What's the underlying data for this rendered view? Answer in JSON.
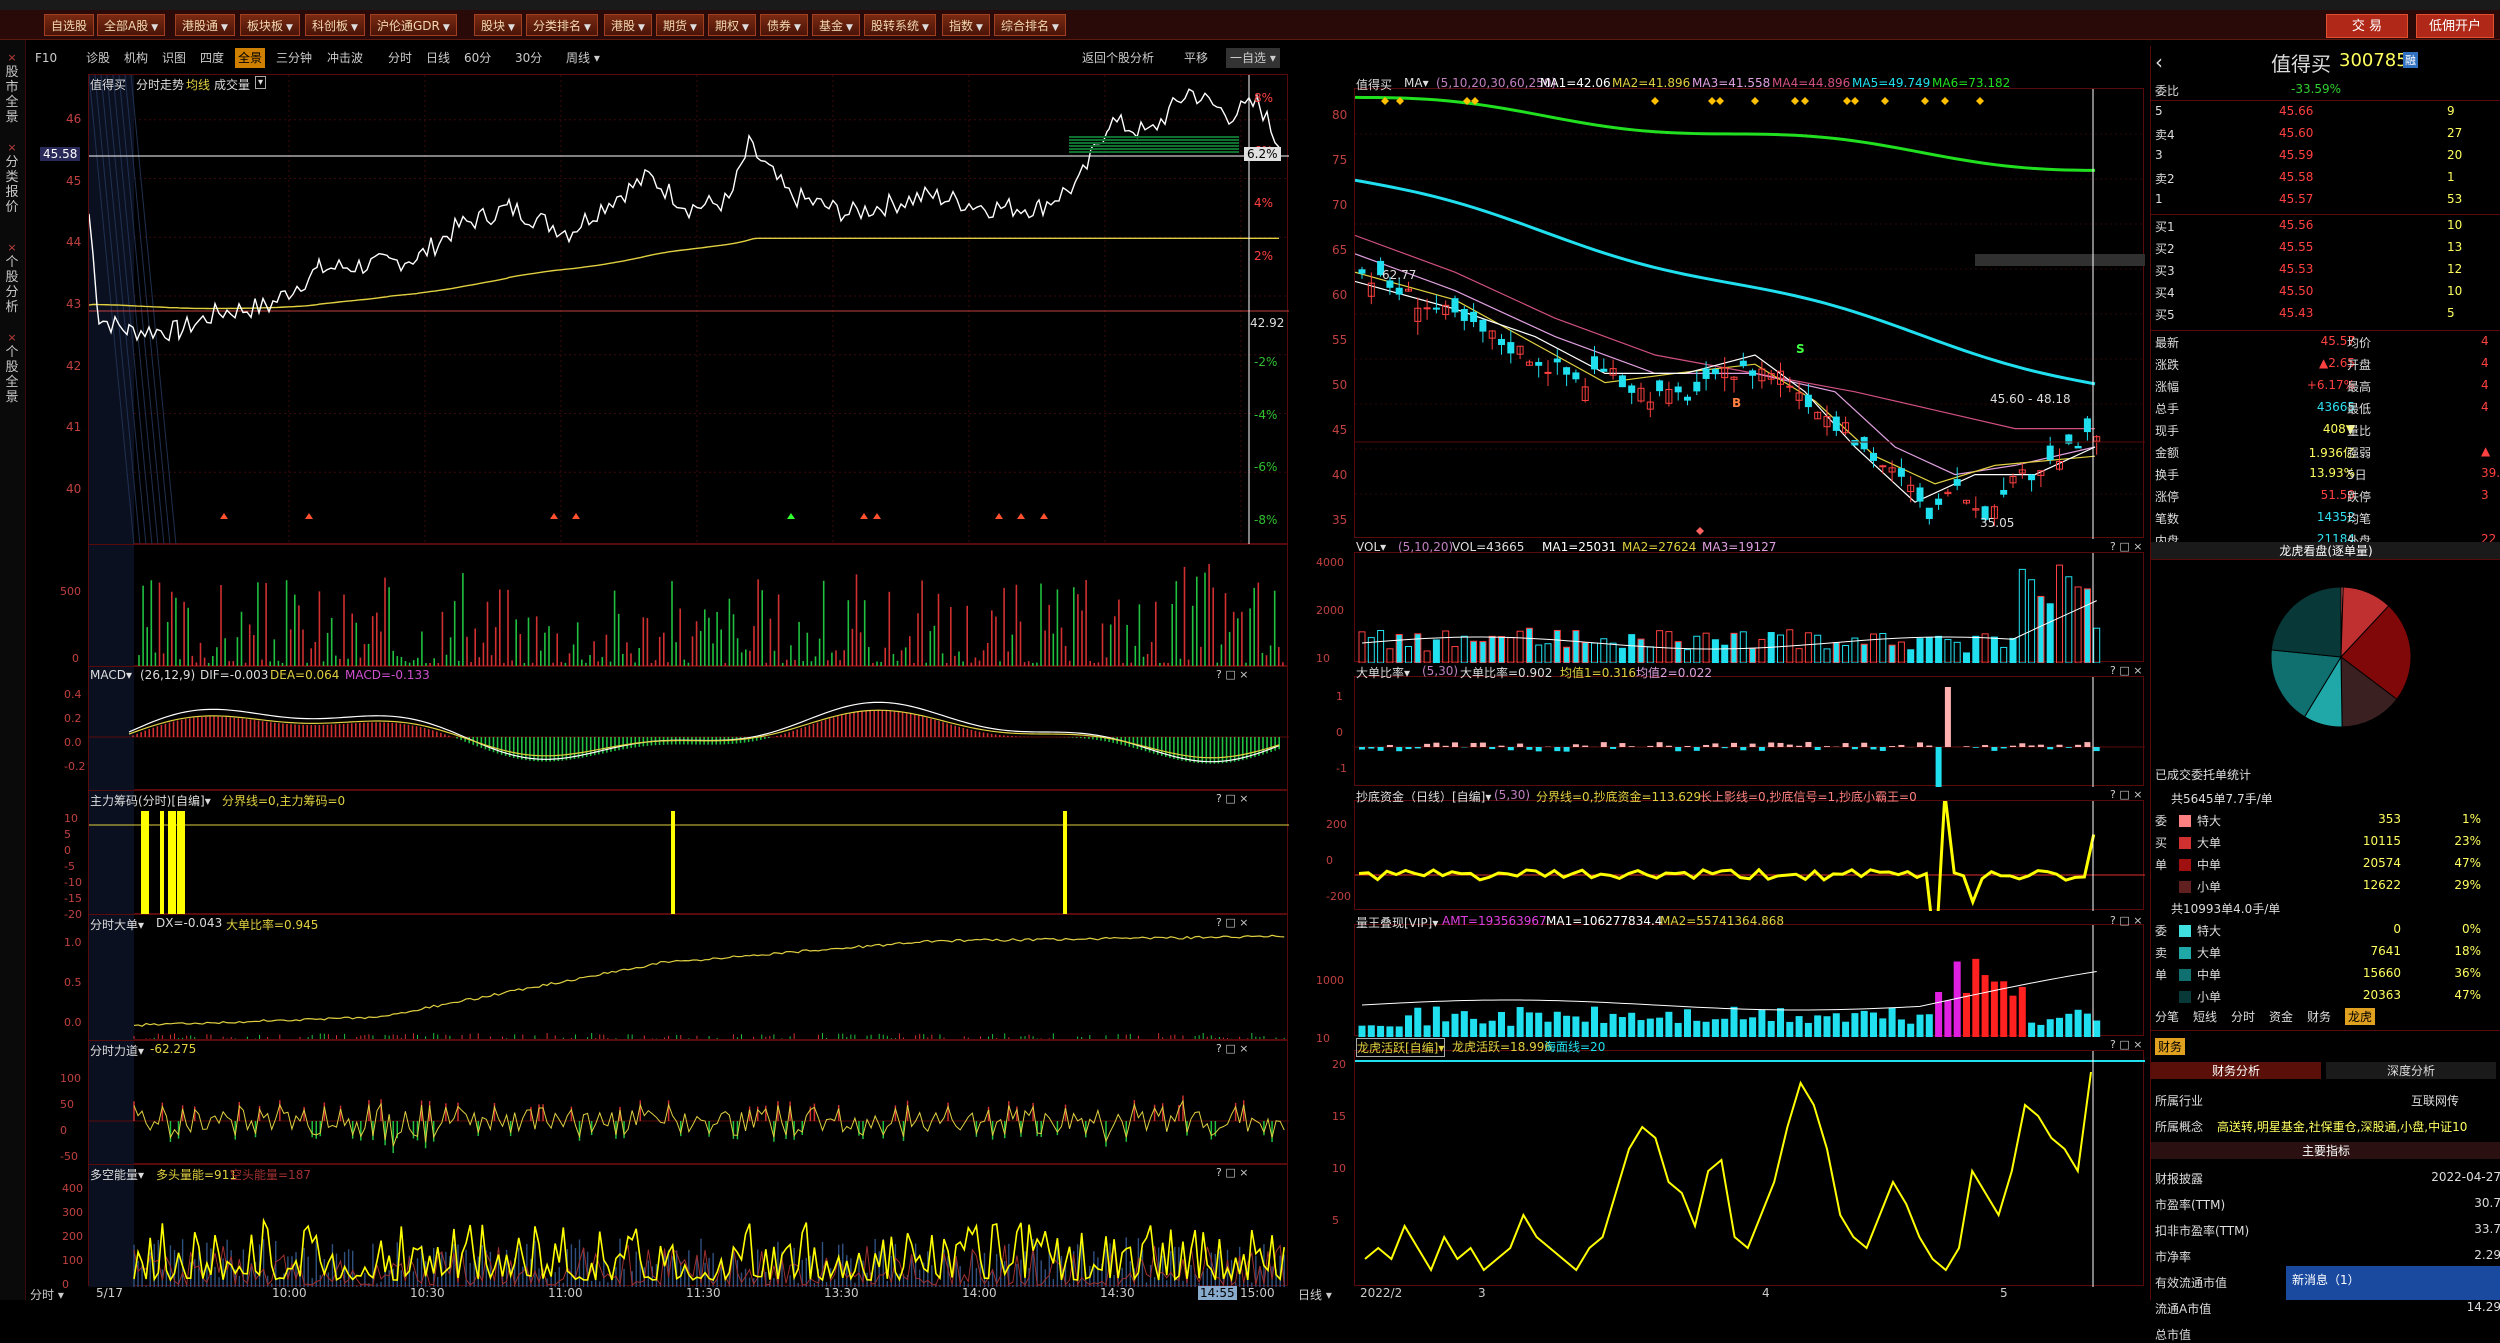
{
  "menu": {
    "items": [
      "自选股",
      "全部A股",
      "港股通",
      "板块板",
      "科创板",
      "沪伦通GDR",
      "股块",
      "分类排名",
      "港股",
      "期货",
      "期权",
      "债券",
      "基金",
      "股转系统",
      "指数",
      "综合排名"
    ],
    "trade": "交 易",
    "open": "低佣开户"
  },
  "left_tabs": [
    "股市全景",
    "分类报价",
    "个股分析",
    "个股全景"
  ],
  "toolbar": {
    "items": [
      "F10",
      "诊股",
      "机构",
      "识图",
      "四度",
      "全景",
      "三分钟",
      "冲击波"
    ],
    "selected": "全景",
    "periods": [
      "分时",
      "日线",
      "60分",
      "30分",
      "周线"
    ],
    "right": [
      "返回个股分析",
      "平移",
      "一自选"
    ]
  },
  "colors": {
    "up": "#ff3030",
    "down": "#00d0d0",
    "yellow": "#ffff00",
    "white": "#ffffff",
    "grid": "#5a0a0a"
  },
  "intraday": {
    "title": "值得买",
    "subtitle": "分时走势",
    "legend": [
      "均线",
      "成交量"
    ],
    "price_ticks": [
      "46",
      "45",
      "44",
      "43",
      "42",
      "41",
      "40"
    ],
    "pct_ticks": [
      "8%",
      "6%",
      "4%",
      "2%",
      "-2%",
      "-4%",
      "-6%",
      "-8%"
    ],
    "current": "45.58",
    "pct_badge": "6.2%",
    "prev_close_label": "42.92",
    "time_ticks": [
      "5/17",
      "10:00",
      "10:30",
      "11:00",
      "11:30",
      "13:30",
      "14:00",
      "14:30",
      "14:55",
      "15:00"
    ],
    "time_btn": "分时"
  },
  "vol_pane": {
    "ticks": [
      "500",
      "0"
    ]
  },
  "macd": {
    "label": "MACD",
    "params": "(26,12,9)",
    "dif": "DIF=-0.003",
    "dea": "DEA=0.064",
    "macd": "MACD=-0.133",
    "ticks": [
      "0.4",
      "0.2",
      "0.0",
      "-0.2"
    ]
  },
  "zlcm": {
    "label": "主力筹码(分时)[自编]",
    "text": "分界线=0,主力筹码=0",
    "ticks": [
      "10",
      "5",
      "0",
      "-5",
      "-10",
      "-15",
      "-20"
    ]
  },
  "fsdd": {
    "label": "分时大单",
    "text": "DX=-0.043",
    "text2": "大单比率=0.945",
    "ticks": [
      "1.0",
      "0.5",
      "0.0"
    ]
  },
  "fsld": {
    "label": "分时力道",
    "text": "-62.275",
    "ticks": [
      "100",
      "50",
      "0",
      "-50"
    ]
  },
  "dkn": {
    "label": "多空能量",
    "text": "多头量能=911",
    "text2": "空头能量=187",
    "ticks": [
      "400",
      "300",
      "200",
      "100",
      "0"
    ]
  },
  "daily": {
    "title": "值得买",
    "ma_label": "MA",
    "ma_params": "(5,10,20,30,60,250)",
    "ma1": "MA1=42.06",
    "ma2": "MA2=41.896",
    "ma3": "MA3=41.558",
    "ma4": "MA4=44.896",
    "ma5": "MA5=49.749",
    "ma6": "MA6=73.182",
    "ticks": [
      "80",
      "75",
      "70",
      "65",
      "60",
      "55",
      "50",
      "45",
      "40",
      "35"
    ],
    "hi": "62.77",
    "lo": "35.05",
    "range": "45.60 - 48.18",
    "b": "B",
    "s": "S",
    "dates": [
      "2022/2",
      "3",
      "4",
      "5"
    ],
    "btn": "日线"
  },
  "dvol": {
    "label": "VOL",
    "params": "(5,10,20)",
    "v": "VOL=43665",
    "ma1": "MA1=25031",
    "ma2": "MA2=27624",
    "ma3": "MA3=19127",
    "ticks": [
      "4000",
      "2000",
      "10"
    ]
  },
  "ddbl": {
    "label": "大单比率",
    "params": "(5,30)",
    "v": "大单比率=0.902",
    "j1": "均值1=0.316",
    "j2": "均值2=0.022",
    "ticks": [
      "1",
      "0",
      "-1"
    ]
  },
  "cdzj": {
    "label": "抄底资金（日线）[自编]",
    "params": "(5,30)",
    "v": "分界线=0,抄底资金=113.629",
    "v2": "长上影线=0,抄底信号=1,抄底小霸王=0",
    "ticks": [
      "200",
      "0",
      "-200"
    ]
  },
  "lwdx": {
    "label": "量王叠现[VIP]",
    "amt": "AMT=193563967",
    "ma1": "MA1=106277834.4",
    "ma2": "MA2=55741364.868",
    "ticks": [
      "1000",
      "10"
    ]
  },
  "lhhy": {
    "label": "龙虎活跃[自编]",
    "v": "龙虎活跃=18.996",
    "v2": "海面线=20",
    "ticks": [
      "20",
      "15",
      "10",
      "5"
    ]
  },
  "quote": {
    "name": "值得买",
    "code": "300785",
    "badge": "融",
    "weibi_l": "委比",
    "weibi": "-33.59%",
    "asks": [
      {
        "l": "卖5",
        "p": "45.66",
        "v": "9"
      },
      {
        "l": "卖4",
        "p": "45.60",
        "v": "27"
      },
      {
        "l": "卖3",
        "p": "45.59",
        "v": "20"
      },
      {
        "l": "卖2",
        "p": "45.58",
        "v": "1"
      },
      {
        "l": "卖1",
        "p": "45.57",
        "v": "53"
      }
    ],
    "bids": [
      {
        "l": "买1",
        "p": "45.56",
        "v": "10"
      },
      {
        "l": "买2",
        "p": "45.55",
        "v": "13"
      },
      {
        "l": "买3",
        "p": "45.53",
        "v": "12"
      },
      {
        "l": "买4",
        "p": "45.50",
        "v": "10"
      },
      {
        "l": "买5",
        "p": "45.43",
        "v": "5"
      }
    ],
    "side_labels": [
      "卖",
      "盘",
      "买",
      "盘"
    ],
    "stats": [
      {
        "l": "最新",
        "v": "45.57",
        "l2": "均价",
        "v2": "4",
        "c": "up"
      },
      {
        "l": "涨跌",
        "v": "▲2.65",
        "l2": "开盘",
        "v2": "4",
        "c": "up"
      },
      {
        "l": "涨幅",
        "v": "+6.17%",
        "l2": "最高",
        "v2": "4",
        "c": "up"
      },
      {
        "l": "总手",
        "v": "43665",
        "l2": "最低",
        "v2": "4",
        "c": "down"
      },
      {
        "l": "现手",
        "v": "408▼",
        "l2": "量比",
        "v2": "",
        "c": "yellow"
      },
      {
        "l": "金额",
        "v": "1.936亿",
        "l2": "强弱",
        "v2": "▲",
        "c": "yellow"
      },
      {
        "l": "换手",
        "v": "13.93%",
        "l2": "5日",
        "v2": "39.",
        "c": "yellow"
      },
      {
        "l": "涨停",
        "v": "51.50",
        "l2": "跌停",
        "v2": "3",
        "c": "up"
      },
      {
        "l": "笔数",
        "v": "14352",
        "l2": "均笔",
        "v2": "",
        "c": "down"
      },
      {
        "l": "内盘",
        "v": "21184",
        "l2": "外盘",
        "v2": "22",
        "c": "down"
      }
    ],
    "lhh_title": "龙虎看盘(逐单量)",
    "order_title": "已成交委托单统计",
    "buy_total": "共5645单7.7手/单",
    "sell_total": "共10993单4.0手/单",
    "buy_rows": [
      {
        "l": "特大",
        "n": "353",
        "p": "1%"
      },
      {
        "l": "大单",
        "n": "10115",
        "p": "23%"
      },
      {
        "l": "中单",
        "n": "20574",
        "p": "47%"
      },
      {
        "l": "小单",
        "n": "12622",
        "p": "29%"
      }
    ],
    "sell_rows": [
      {
        "l": "特大",
        "n": "0",
        "p": "0%"
      },
      {
        "l": "大单",
        "n": "7641",
        "p": "18%"
      },
      {
        "l": "中单",
        "n": "15660",
        "p": "36%"
      },
      {
        "l": "小单",
        "n": "20363",
        "p": "47%"
      }
    ],
    "buy_side": [
      "委",
      "买",
      "单"
    ],
    "sell_side": [
      "委",
      "卖",
      "单"
    ],
    "tabs": [
      "分笔",
      "短线",
      "分时",
      "资金",
      "财务",
      "龙虎"
    ],
    "tab_sel": "龙虎",
    "fin_tab": "财务",
    "fin_tabs": [
      "财务分析",
      "深度分析"
    ],
    "industry_l": "所属行业",
    "industry": "互联网传",
    "concept_l": "所属概念",
    "concept": "高送转,明星基金,社保重仓,深股通,小盘,中证10",
    "main_idx": "主要指标",
    "fin_rows": [
      {
        "l": "财报披露",
        "v": "2022-04-27"
      },
      {
        "l": "市盈率(TTM)",
        "v": "30.7"
      },
      {
        "l": "扣非市盈率(TTM)",
        "v": "33.7"
      },
      {
        "l": "市净率",
        "v": "2.29"
      },
      {
        "l": "有效流通市值",
        "v": "14.29"
      },
      {
        "l": "流通A市值",
        "v": "14.29"
      },
      {
        "l": "总市值",
        "v": ""
      }
    ],
    "news": "新消息（1）"
  },
  "pie": {
    "slices": [
      {
        "v": 1,
        "color": "#e06060"
      },
      {
        "v": 23,
        "color": "#c03030"
      },
      {
        "v": 47,
        "color": "#800808"
      },
      {
        "v": 29,
        "color": "#3a2020"
      },
      {
        "v": 0,
        "color": "#40e0e0"
      },
      {
        "v": 18,
        "color": "#20a8a8"
      },
      {
        "v": 36,
        "color": "#107070"
      },
      {
        "v": 47,
        "color": "#083838"
      }
    ]
  }
}
